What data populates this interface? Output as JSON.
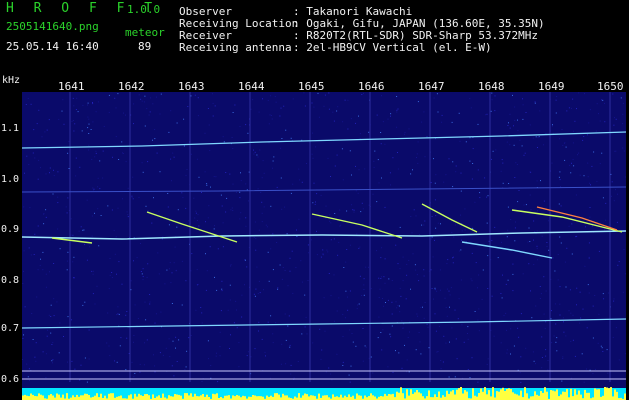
{
  "header": {
    "app_title": "H R O F F T",
    "version": "1.0.0",
    "filename": "2505141640.png",
    "datetime": "25.05.14 16:40",
    "meteor_label": "meteor",
    "meteor_count": "89",
    "observer_label": "Observer",
    "observer_value": ": Takanori Kawachi",
    "location_label": "Receiving Location",
    "location_value": ": Ogaki, Gifu, JAPAN (136.60E, 35.35N)",
    "receiver_label": "Receiver",
    "receiver_value": ": R820T2(RTL-SDR) SDR-Sharp 53.372MHz",
    "antenna_label": "Receiving antenna",
    "antenna_value": ": 2el-HB9CV Vertical (el. E-W)"
  },
  "axis": {
    "unit": "kHz",
    "time_ticks": [
      "1641",
      "1642",
      "1643",
      "1644",
      "1645",
      "1646",
      "1647",
      "1648",
      "1649",
      "1650"
    ],
    "freq_ticks": [
      "1.1",
      "1.0",
      "0.9",
      "0.8",
      "0.7",
      "0.6"
    ]
  },
  "colors": {
    "background": "#0a0a6a",
    "signal": "#7fd8ff",
    "meteor": "#c8ff60",
    "baseline": "#00e5ff",
    "peaks": "#ffff40"
  }
}
